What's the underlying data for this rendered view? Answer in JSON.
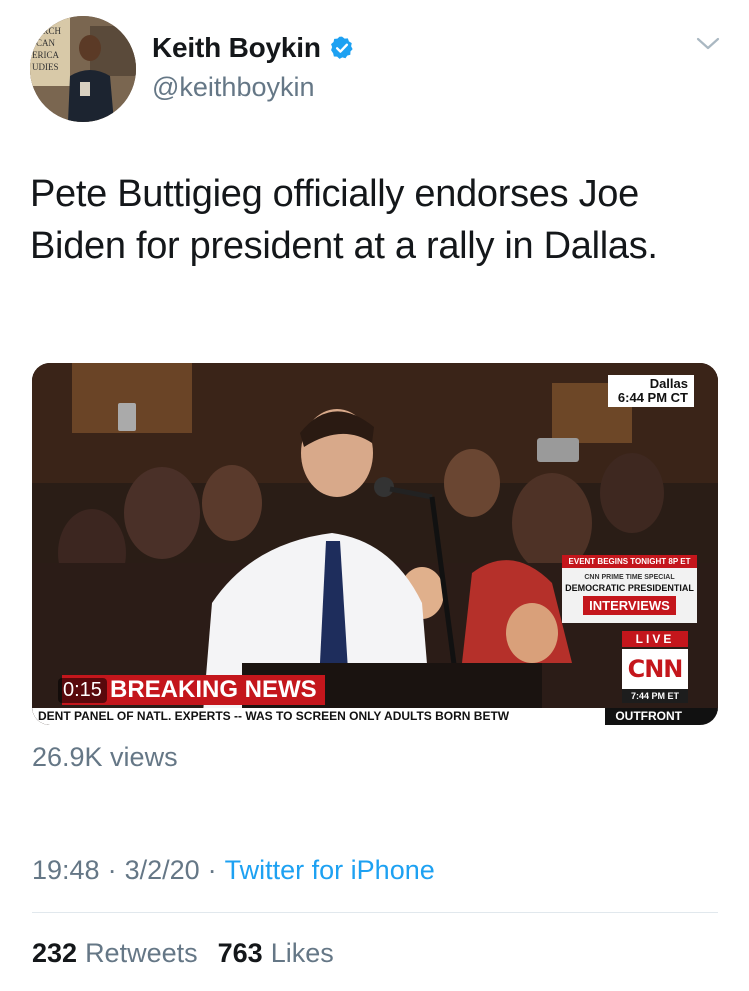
{
  "author": {
    "display_name": "Keith Boykin",
    "handle": "@keithboykin",
    "avatar_sign_text": "ARCH\nCAN\nERICA\nUDIES"
  },
  "tweet": {
    "text": "Pete Buttigieg officially endorses Joe Biden for president at a rally in Dallas."
  },
  "video": {
    "timer": "0:15",
    "location": "Dallas",
    "local_time": "6:44 PM CT",
    "promo_top": "EVENT BEGINS TONIGHT 8P ET",
    "promo_line1": "CNN PRIME TIME SPECIAL",
    "promo_line2": "DEMOCRATIC PRESIDENTIAL",
    "promo_line3": "INTERVIEWS",
    "live_label": "LIVE",
    "network": "CNN",
    "et_time": "7:44 PM ET",
    "banner": "BREAKING NEWS",
    "ticker": "DENT PANEL OF NATL. EXPERTS -- WAS TO SCREEN ONLY ADULTS BORN BETW",
    "show": "OUTFRONT"
  },
  "views": "26.9K views",
  "meta": {
    "time": "19:48",
    "separator": "·",
    "date": "3/2/20",
    "source": "Twitter for iPhone"
  },
  "stats": {
    "retweets_count": "232",
    "retweets_label": "Retweets",
    "likes_count": "763",
    "likes_label": "Likes"
  },
  "colors": {
    "twitter_blue": "#1da1f2",
    "secondary_text": "#657786",
    "cnn_red": "#c4161c"
  }
}
